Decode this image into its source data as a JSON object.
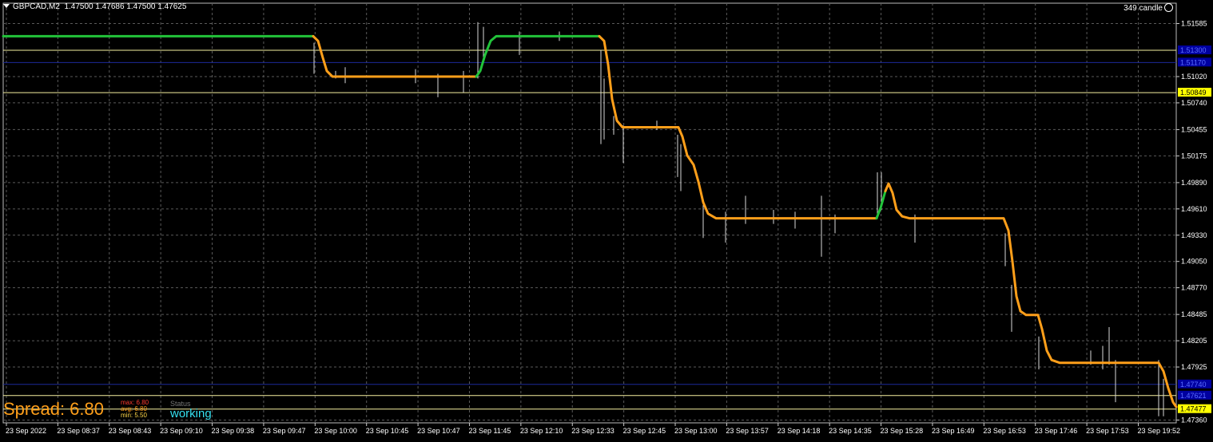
{
  "header": {
    "symbol": "GBPCAD,M2",
    "ohlc": "1.47500 1.47686 1.47500 1.47625",
    "candle_info": "349 candle"
  },
  "panel": {
    "spread_text": "Spread: 6.80",
    "max_text": "max: 6.80",
    "avg_text": "avg: 6.80",
    "min_text": "min: 5.50",
    "status_label": "Status",
    "status_value": "working"
  },
  "colors": {
    "background": "#000000",
    "grid": "#5a5a5a",
    "price_up": "#22c33a",
    "price_down": "#ff9f1a",
    "level_line": "#f5f0a0",
    "blue_line": "#1c2a9a",
    "label_yellow": "#ffff00",
    "label_blue": "#0000a0"
  },
  "chart_data": {
    "type": "line",
    "price_ticks": [
      "1.51585",
      "1.51020",
      "1.50740",
      "1.50455",
      "1.50175",
      "1.49890",
      "1.49610",
      "1.49330",
      "1.49050",
      "1.48770",
      "1.48485",
      "1.48205",
      "1.47925",
      "1.47360"
    ],
    "time_ticks": [
      "23 Sep 2022",
      "23 Sep 08:37",
      "23 Sep 08:43",
      "23 Sep 09:10",
      "23 Sep 09:38",
      "23 Sep 09:47",
      "23 Sep 10:00",
      "23 Sep 10:45",
      "23 Sep 10:47",
      "23 Sep 11:45",
      "23 Sep 12:10",
      "23 Sep 12:33",
      "23 Sep 12:45",
      "23 Sep 13:00",
      "23 Sep 13:57",
      "23 Sep 14:18",
      "23 Sep 14:35",
      "23 Sep 15:28",
      "23 Sep 16:49",
      "23 Sep 16:53",
      "23 Sep 17:46",
      "23 Sep 17:53",
      "23 Sep 19:52"
    ],
    "ylim": [
      1.4733,
      1.517
    ],
    "levels": [
      {
        "price": 1.513,
        "label": "1.51300",
        "style": "yellow-line",
        "label_style": "blue"
      },
      {
        "price": 1.5117,
        "label": "1.51170",
        "style": "blue-line",
        "label_style": "blue"
      },
      {
        "price": 1.50849,
        "label": "1.50849",
        "style": "yellow-line",
        "label_style": "yellow"
      },
      {
        "price": 1.4774,
        "label": "1.47740",
        "style": "blue-line",
        "label_style": "blue"
      },
      {
        "price": 1.47621,
        "label": "1.47621",
        "style": "yellow-line",
        "label_style": "blue"
      },
      {
        "price": 1.47477,
        "label": "1.47477",
        "style": "yellow-line",
        "label_style": "yellow"
      }
    ],
    "series": [
      {
        "points": [
          [
            0,
            1.5145,
            "up"
          ],
          [
            388,
            1.5145,
            "up"
          ],
          [
            394,
            1.514,
            "down"
          ],
          [
            400,
            1.5122,
            "down"
          ],
          [
            405,
            1.5108,
            "down"
          ],
          [
            412,
            1.5102,
            "down"
          ],
          [
            592,
            1.5102,
            "down"
          ],
          [
            597,
            1.5108,
            "up"
          ],
          [
            603,
            1.5125,
            "up"
          ],
          [
            610,
            1.514,
            "up"
          ],
          [
            617,
            1.5145,
            "up"
          ],
          [
            746,
            1.5145,
            "up"
          ],
          [
            752,
            1.514,
            "down"
          ],
          [
            757,
            1.5115,
            "down"
          ],
          [
            762,
            1.5078,
            "down"
          ],
          [
            768,
            1.5055,
            "down"
          ],
          [
            775,
            1.5048,
            "down"
          ],
          [
            845,
            1.5048,
            "down"
          ],
          [
            850,
            1.5038,
            "down"
          ],
          [
            856,
            1.5018,
            "down"
          ],
          [
            864,
            1.5008,
            "down"
          ],
          [
            870,
            1.499,
            "down"
          ],
          [
            876,
            1.4968,
            "down"
          ],
          [
            882,
            1.4956,
            "down"
          ],
          [
            892,
            1.4951,
            "down"
          ],
          [
            1093,
            1.4951,
            "down"
          ],
          [
            1098,
            1.4962,
            "up"
          ],
          [
            1104,
            1.498,
            "up"
          ],
          [
            1108,
            1.4988,
            "down"
          ],
          [
            1113,
            1.4978,
            "down"
          ],
          [
            1118,
            1.496,
            "down"
          ],
          [
            1125,
            1.4953,
            "down"
          ],
          [
            1134,
            1.4951,
            "down"
          ],
          [
            1252,
            1.4951,
            "down"
          ],
          [
            1258,
            1.4938,
            "down"
          ],
          [
            1263,
            1.4905,
            "down"
          ],
          [
            1268,
            1.4868,
            "down"
          ],
          [
            1273,
            1.4852,
            "down"
          ],
          [
            1280,
            1.4848,
            "down"
          ],
          [
            1295,
            1.4848,
            "down"
          ],
          [
            1300,
            1.4833,
            "down"
          ],
          [
            1306,
            1.481,
            "down"
          ],
          [
            1312,
            1.48,
            "down"
          ],
          [
            1322,
            1.4797,
            "down"
          ],
          [
            1446,
            1.4797,
            "down"
          ],
          [
            1452,
            1.4788,
            "down"
          ],
          [
            1458,
            1.477,
            "down"
          ],
          [
            1464,
            1.4755,
            "down"
          ],
          [
            1468,
            1.475,
            "down"
          ]
        ]
      }
    ],
    "spikes": [
      [
        393,
        1.5138,
        1.5105
      ],
      [
        420,
        1.5108,
        1.51
      ],
      [
        432,
        1.5112,
        1.5095
      ],
      [
        520,
        1.511,
        1.5095
      ],
      [
        548,
        1.5105,
        1.508
      ],
      [
        580,
        1.5108,
        1.5085
      ],
      [
        598,
        1.516,
        1.51
      ],
      [
        605,
        1.5155,
        1.512
      ],
      [
        650,
        1.515,
        1.5125
      ],
      [
        700,
        1.515,
        1.514
      ],
      [
        752,
        1.513,
        1.503
      ],
      [
        756,
        1.51,
        1.5035
      ],
      [
        768,
        1.506,
        1.504
      ],
      [
        780,
        1.505,
        1.501
      ],
      [
        822,
        1.5055,
        1.5045
      ],
      [
        848,
        1.504,
        1.4995
      ],
      [
        852,
        1.503,
        1.498
      ],
      [
        880,
        1.4965,
        1.493
      ],
      [
        908,
        1.4958,
        1.4925
      ],
      [
        933,
        1.4975,
        1.4945
      ],
      [
        968,
        1.496,
        1.4945
      ],
      [
        995,
        1.4958,
        1.494
      ],
      [
        1028,
        1.4975,
        1.491
      ],
      [
        1045,
        1.4955,
        1.4935
      ],
      [
        1098,
        1.5,
        1.4955
      ],
      [
        1103,
        1.5,
        1.496
      ],
      [
        1145,
        1.4955,
        1.4925
      ],
      [
        1258,
        1.4935,
        1.49
      ],
      [
        1266,
        1.488,
        1.483
      ],
      [
        1300,
        1.4825,
        1.479
      ],
      [
        1365,
        1.481,
        1.4795
      ],
      [
        1380,
        1.4815,
        1.479
      ],
      [
        1388,
        1.4835,
        1.4795
      ],
      [
        1396,
        1.48,
        1.4755
      ],
      [
        1450,
        1.48,
        1.474
      ],
      [
        1456,
        1.478,
        1.474
      ]
    ]
  }
}
